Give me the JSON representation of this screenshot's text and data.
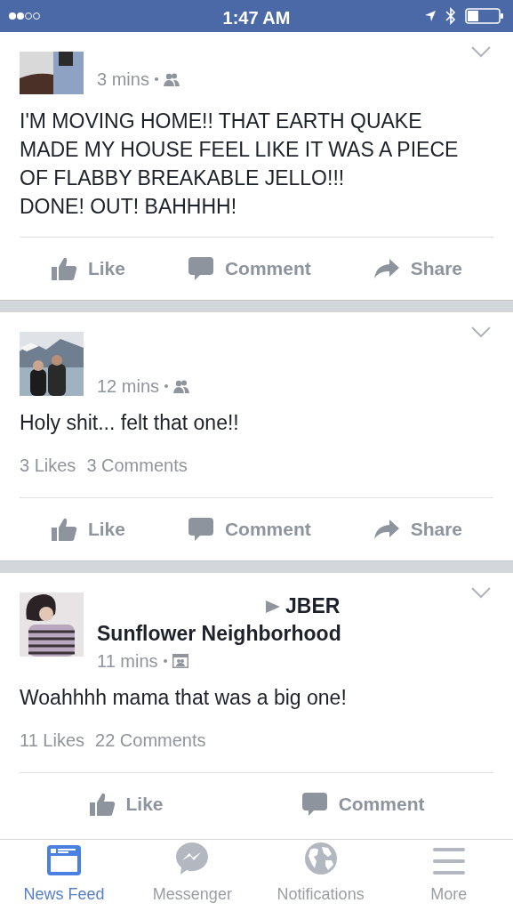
{
  "status_bar": {
    "time": "1:47 AM"
  },
  "posts": [
    {
      "time": "3 mins",
      "audience_icon": {
        "kind": "friends"
      },
      "text": [
        "I'M MOVING HOME!! THAT EARTH QUAKE MADE MY HOUSE FEEL LIKE IT WAS A PIECE OF FLABBY BREAKABLE JELLO!!!",
        "DONE! OUT! BAHHHH!"
      ],
      "actions": [
        {
          "kind": "like",
          "label": "Like"
        },
        {
          "kind": "comment",
          "label": "Comment"
        },
        {
          "kind": "share",
          "label": "Share"
        }
      ]
    },
    {
      "time": "12 mins",
      "audience_icon": {
        "kind": "friends"
      },
      "text": [
        "Holy shit...  felt that one!!"
      ],
      "likes": "3 Likes",
      "comments": "3 Comments",
      "actions": [
        {
          "kind": "like",
          "label": "Like"
        },
        {
          "kind": "comment",
          "label": "Comment"
        },
        {
          "kind": "share",
          "label": "Share"
        }
      ]
    },
    {
      "group_lines": [
        "JBER",
        "Sunflower Neighborhood"
      ],
      "time": "11 mins",
      "audience_icon": {
        "kind": "group"
      },
      "text": [
        "Woahhhh mama that was a big one!"
      ],
      "likes": "11 Likes",
      "comments": "22 Comments",
      "actions": [
        {
          "kind": "like",
          "label": "Like"
        },
        {
          "kind": "comment",
          "label": "Comment"
        }
      ]
    }
  ],
  "tab_bar": [
    {
      "kind": "feed",
      "label": "News Feed",
      "selected": true
    },
    {
      "kind": "messenger",
      "label": "Messenger",
      "selected": false
    },
    {
      "kind": "globe",
      "label": "Notifications",
      "selected": false
    },
    {
      "kind": "menu",
      "label": "More",
      "selected": false
    }
  ]
}
